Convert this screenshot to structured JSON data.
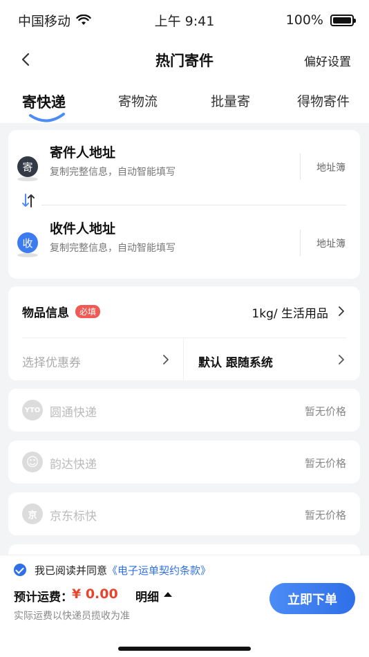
{
  "status": {
    "carrier": "中国移动",
    "time": "上午 9:41",
    "battery": "100%"
  },
  "nav": {
    "title": "热门寄件",
    "right": "偏好设置"
  },
  "tabs": [
    {
      "label": "寄快递",
      "active": true
    },
    {
      "label": "寄物流",
      "active": false
    },
    {
      "label": "批量寄",
      "active": false
    },
    {
      "label": "得物寄件",
      "active": false
    }
  ],
  "sender": {
    "badge": "寄",
    "title": "寄件人地址",
    "subtitle": "复制完整信息，自动智能填写",
    "book": "地址簿"
  },
  "receiver": {
    "badge": "收",
    "title": "收件人地址",
    "subtitle": "复制完整信息，自动智能填写",
    "book": "地址簿"
  },
  "goods": {
    "label": "物品信息",
    "required": "必填",
    "value": "1kg/ 生活用品",
    "coupon": "选择优惠券",
    "follow": "默认 跟随系统"
  },
  "carriers": [
    {
      "name": "圆通快递",
      "price": "暂无价格",
      "logo": "yto-logo-icon",
      "glyph": "YTO"
    },
    {
      "name": "韵达快递",
      "price": "暂无价格",
      "logo": "yunda-logo-icon",
      "glyph": "☺"
    },
    {
      "name": "京东标快",
      "price": "暂无价格",
      "logo": "jd-logo-icon",
      "glyph": "京"
    }
  ],
  "footer": {
    "agree_prefix": "我已阅读并同意",
    "agree_link": "《电子运单契约条款》",
    "fee_label": "预计运费：",
    "fee_value": "¥ 0.00",
    "detail": "明细",
    "note": "实际运费以快递员揽收为准",
    "order_button": "立即下单"
  },
  "colors": {
    "accent": "#2f6fe8",
    "price": "#e8452d",
    "required": "#ef5a55"
  }
}
